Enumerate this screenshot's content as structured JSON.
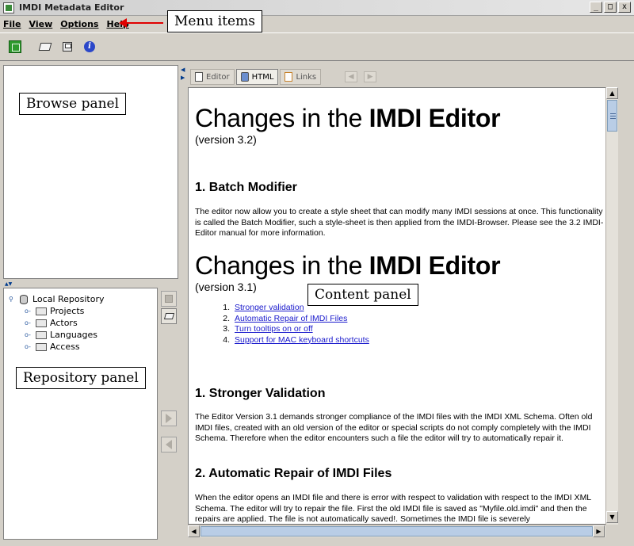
{
  "window": {
    "title": "IMDI Metadata Editor",
    "controls": [
      "_",
      "□",
      "x"
    ]
  },
  "menu": {
    "items": [
      "File",
      "View",
      "Options",
      "Help"
    ]
  },
  "toolbar": {
    "buttons": [
      "new-icon",
      "open-icon",
      "save-icon",
      "info-icon"
    ]
  },
  "repository": {
    "root": "Local Repository",
    "children": [
      "Projects",
      "Actors",
      "Languages",
      "Access"
    ]
  },
  "tabs": {
    "items": [
      "Editor",
      "HTML",
      "Links"
    ],
    "active": "HTML"
  },
  "content": {
    "h1_prefix": "Changes in the ",
    "h1_bold": "IMDI Editor",
    "v32": "(version 3.2)",
    "sec_batch": "1. Batch Modifier",
    "batch_text": "The editor now allow you to create a style sheet that can modify many IMDI sessions at once. This functionality is called the Batch Modifier, such a style-sheet is then applied from the IMDI-Browser. Please see the 3.2 IMDI-Editor manual for more information.",
    "v31": "(version 3.1)",
    "toc": [
      {
        "num": "1.",
        "label": "Stronger validation"
      },
      {
        "num": "2.",
        "label": "Automatic Repair of IMDI Files"
      },
      {
        "num": "3.",
        "label": "Turn tooltips on or off"
      },
      {
        "num": "4.",
        "label": "Support for MAC keyboard shortcuts"
      }
    ],
    "sec_validation": "1. Stronger Validation",
    "validation_text": "The Editor Version 3.1 demands stronger compliance of the IMDI files with the IMDI XML Schema. Often old IMDI files, created with an old version of the editor or special scripts do not comply completely with the IMDI Schema. Therefore when the editor encounters such a file the editor will try to automatically repair it.",
    "sec_repair": "2. Automatic Repair of IMDI Files",
    "repair_text": "When the editor opens an IMDI file and there is error with respect to validation with respect to the IMDI XML Schema. The editor will try to repair the file. First the old IMDI file is saved as \"Myfile.old.imdi\" and then the repairs are applied. The file is not automatically saved!. Sometimes the IMDI file is severely"
  },
  "annotations": {
    "menu_items": "Menu items",
    "browse_panel": "Browse panel",
    "repository_panel": "Repository panel",
    "content_panel": "Content panel"
  },
  "colors": {
    "annotation_arrow": "#e00000",
    "link": "#1a1acc",
    "window_bg": "#d4d0c8"
  }
}
